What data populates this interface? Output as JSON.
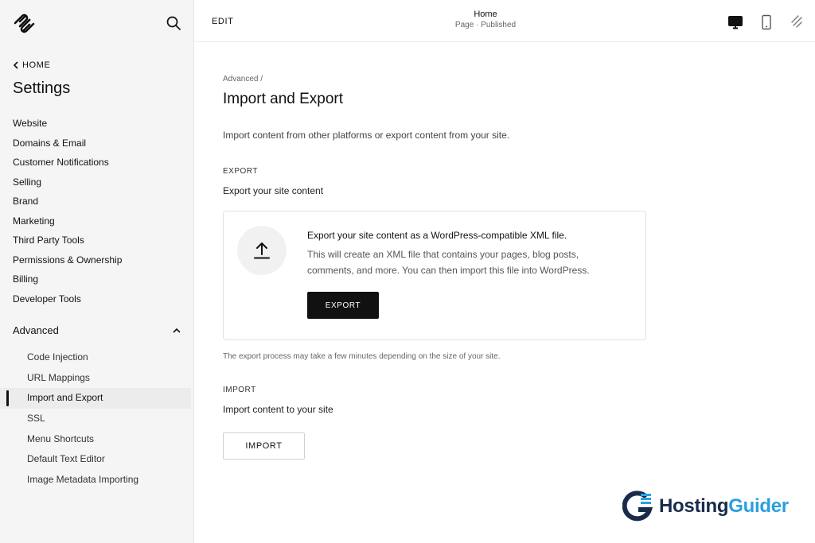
{
  "sidebar": {
    "back_label": "HOME",
    "title": "Settings",
    "items": [
      {
        "label": "Website"
      },
      {
        "label": "Domains & Email"
      },
      {
        "label": "Customer Notifications"
      },
      {
        "label": "Selling"
      },
      {
        "label": "Brand"
      },
      {
        "label": "Marketing"
      },
      {
        "label": "Third Party Tools"
      },
      {
        "label": "Permissions & Ownership"
      },
      {
        "label": "Billing"
      },
      {
        "label": "Developer Tools"
      }
    ],
    "advanced": {
      "label": "Advanced",
      "expanded": true,
      "items": [
        {
          "label": "Code Injection"
        },
        {
          "label": "URL Mappings"
        },
        {
          "label": "Import and Export",
          "active": true
        },
        {
          "label": "SSL"
        },
        {
          "label": "Menu Shortcuts"
        },
        {
          "label": "Default Text Editor"
        },
        {
          "label": "Image Metadata Importing"
        }
      ]
    }
  },
  "topbar": {
    "edit_label": "EDIT",
    "page_name": "Home",
    "page_status": "Page · Published",
    "icons": [
      "desktop-icon",
      "mobile-icon",
      "expand-icon"
    ]
  },
  "main": {
    "breadcrumb": "Advanced /",
    "title": "Import and Export",
    "intro": "Import content from other platforms or export content from your site.",
    "export": {
      "label": "EXPORT",
      "subtitle": "Export your site content",
      "card_heading": "Export your site content as a WordPress-compatible XML file.",
      "card_description": "This will create an XML file that contains your pages, blog posts, comments, and more. You can then import this file into WordPress.",
      "button_label": "EXPORT",
      "note": "The export process may take a few minutes depending on the size of your site."
    },
    "import": {
      "label": "IMPORT",
      "subtitle": "Import content to your site",
      "button_label": "IMPORT"
    }
  },
  "watermark": {
    "text_1": "Hosting",
    "text_2": "Guider",
    "colors": {
      "dark": "#1a2a4a",
      "accent": "#2a9fe0"
    }
  }
}
